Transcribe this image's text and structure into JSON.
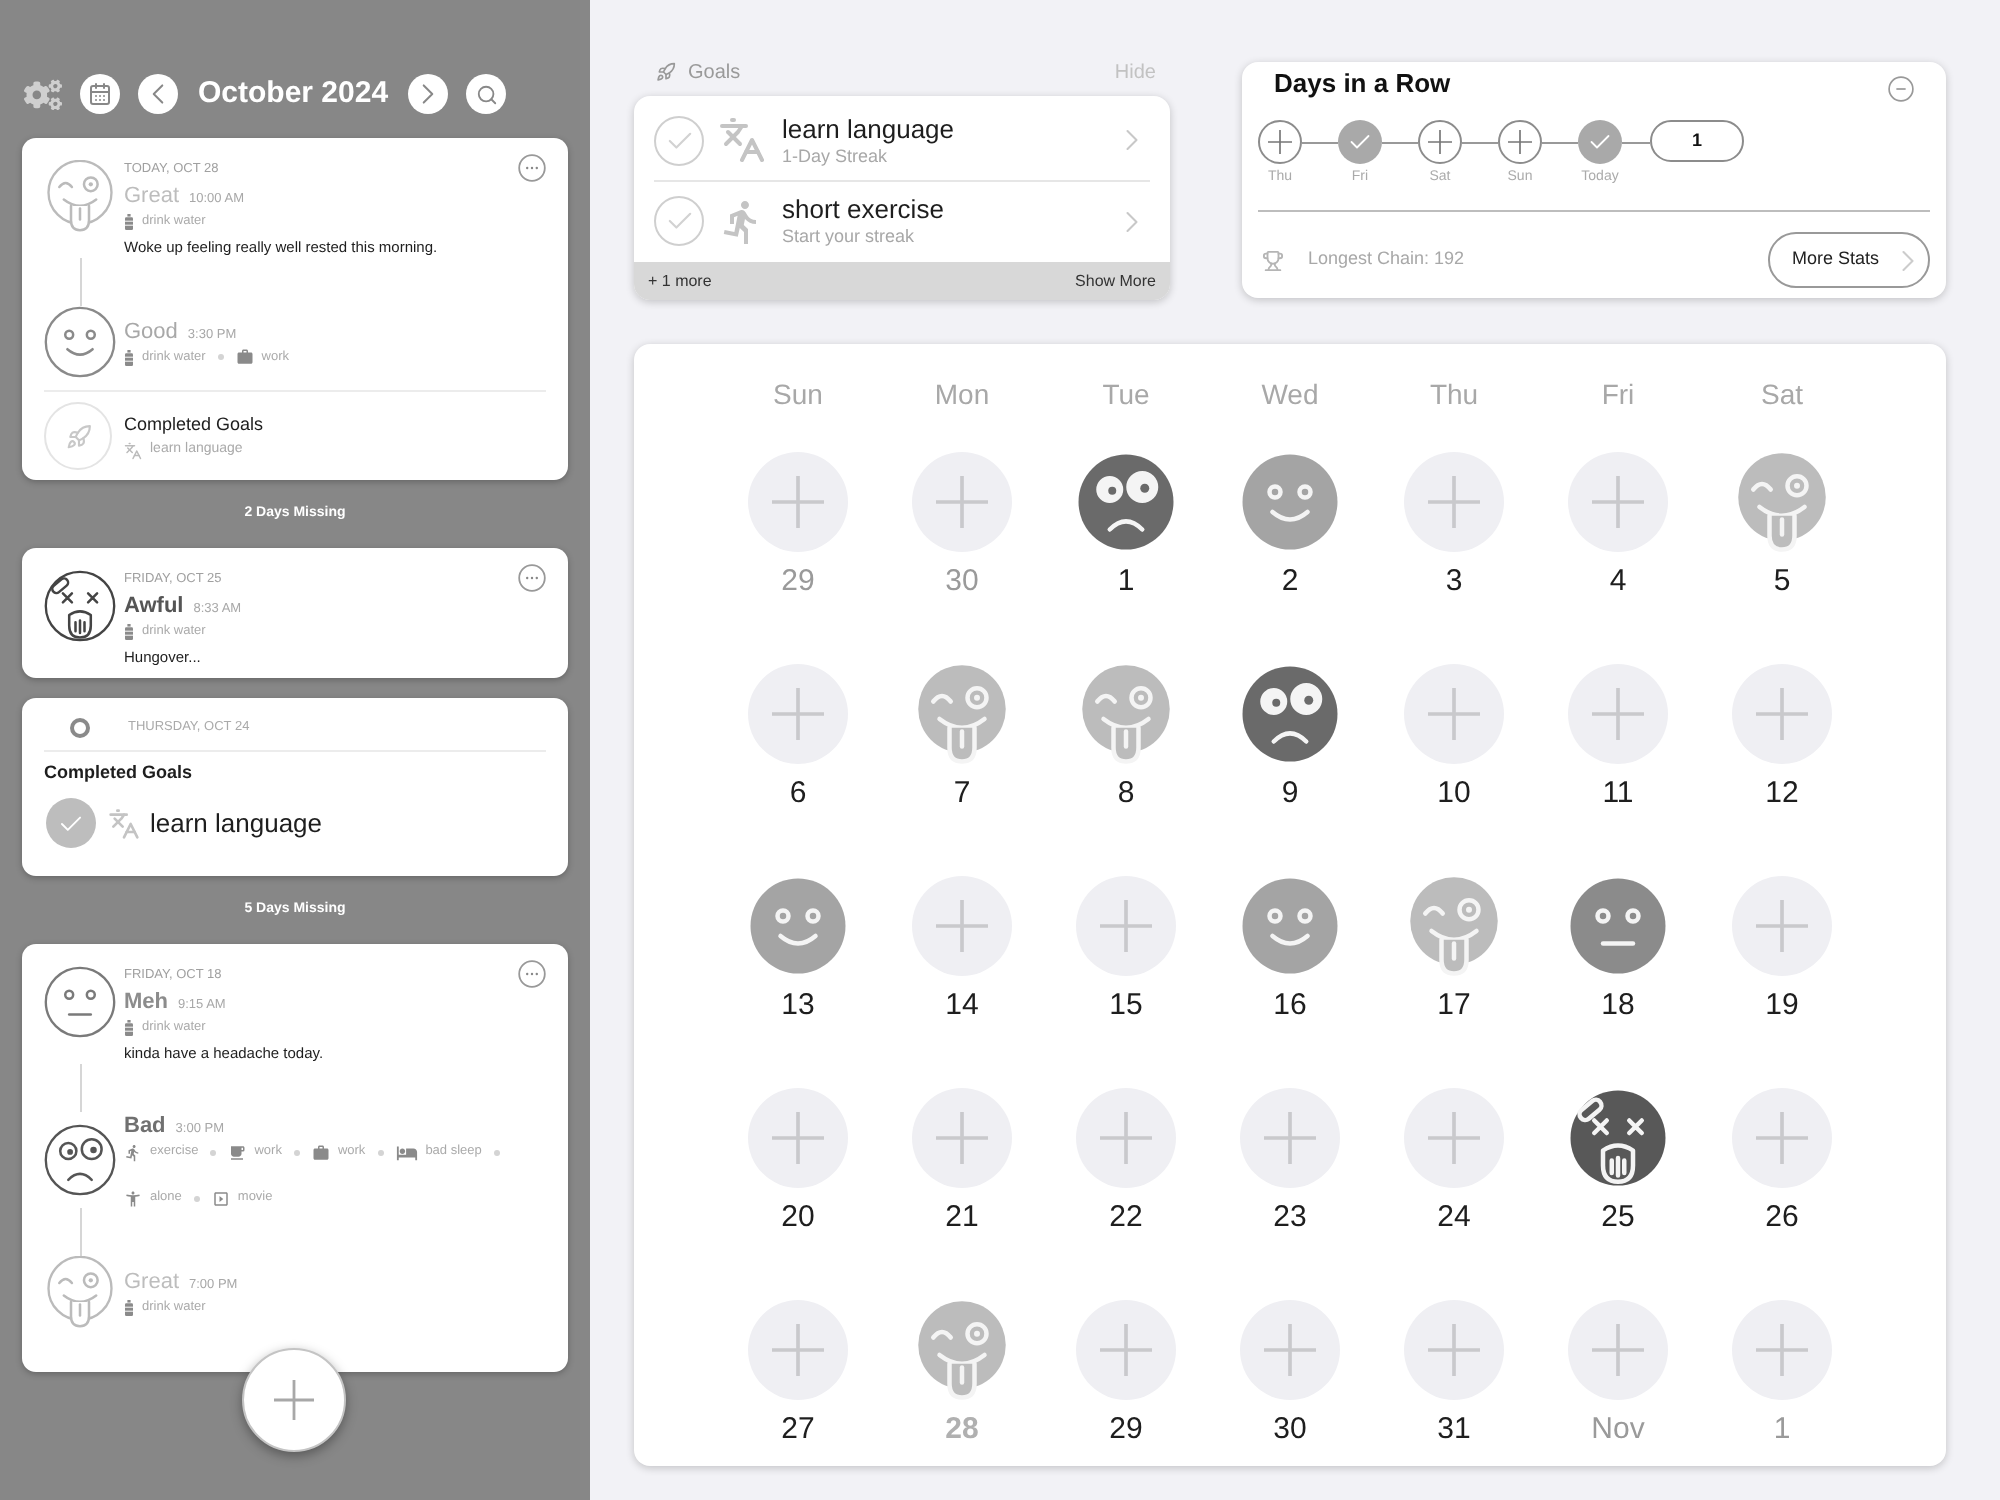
{
  "sidebar": {
    "header": {
      "title": "October 2024"
    },
    "timeline": [
      {
        "kind": "card",
        "date": "TODAY, OCT 28",
        "entries": [
          {
            "kind": "great",
            "label": "Great",
            "time": "10:00 AM",
            "activities": [
              {
                "kind": "water",
                "label": "drink water"
              }
            ],
            "note": "Woke up feeling really well rested this morning."
          },
          {
            "kind": "good",
            "label": "Good",
            "time": "3:30 PM",
            "activities": [
              {
                "kind": "water",
                "label": "drink water"
              },
              {
                "kind": "briefcase",
                "label": "work"
              }
            ]
          }
        ],
        "completed_goals": {
          "title": "Completed Goals",
          "goals": [
            {
              "kind": "language",
              "label": "learn language"
            }
          ]
        }
      },
      {
        "kind": "gap",
        "label": "2 Days Missing"
      },
      {
        "kind": "card",
        "date": "FRIDAY, OCT 25",
        "entries": [
          {
            "kind": "awful",
            "label": "Awful",
            "time": "8:33 AM",
            "activities": [
              {
                "kind": "water",
                "label": "drink water"
              }
            ],
            "note": "Hungover..."
          }
        ]
      },
      {
        "kind": "goals_card",
        "date": "THURSDAY, OCT 24",
        "title": "Completed Goals",
        "goals": [
          {
            "kind": "language",
            "label": "learn language",
            "checked": true
          }
        ]
      },
      {
        "kind": "gap",
        "label": "5 Days Missing"
      },
      {
        "kind": "card",
        "date": "FRIDAY, OCT 18",
        "entries": [
          {
            "kind": "meh",
            "label": "Meh",
            "time": "9:15 AM",
            "activities": [
              {
                "kind": "water",
                "label": "drink water"
              }
            ],
            "note": "kinda have a headache today."
          },
          {
            "kind": "bad",
            "label": "Bad",
            "time": "3:00 PM",
            "activities": [
              {
                "kind": "exercise",
                "label": "exercise"
              },
              {
                "kind": "cup",
                "label": "work"
              },
              {
                "kind": "briefcase",
                "label": "work"
              },
              {
                "kind": "bed",
                "label": "bad sleep"
              },
              {
                "kind": "person",
                "label": "alone"
              },
              {
                "kind": "movie",
                "label": "movie"
              }
            ]
          },
          {
            "kind": "great",
            "label": "Great",
            "time": "7:00 PM",
            "activities": [
              {
                "kind": "water",
                "label": "drink water"
              }
            ]
          }
        ]
      }
    ]
  },
  "goals": {
    "title": "Goals",
    "hide": "Hide",
    "items": [
      {
        "kind": "language",
        "title": "learn language",
        "subtitle": "1-Day Streak",
        "checked": false
      },
      {
        "kind": "exercise",
        "title": "short exercise",
        "subtitle": "Start your streak",
        "checked": false
      }
    ],
    "more": "+ 1 more",
    "show_more": "Show More"
  },
  "streak": {
    "title": "Days in a Row",
    "days": [
      {
        "label": "Thu",
        "kind": "missing"
      },
      {
        "label": "Fri",
        "kind": "done"
      },
      {
        "label": "Sat",
        "kind": "missing"
      },
      {
        "label": "Sun",
        "kind": "missing"
      },
      {
        "label": "Today",
        "kind": "done"
      }
    ],
    "count": "1",
    "longest": "Longest Chain: 192",
    "button": "More Stats"
  },
  "calendar": {
    "weekdays": [
      "Sun",
      "Mon",
      "Tue",
      "Wed",
      "Thu",
      "Fri",
      "Sat"
    ],
    "days": [
      {
        "label": "29",
        "kind": "none",
        "other_month": true,
        "today": false
      },
      {
        "label": "30",
        "kind": "none",
        "other_month": true,
        "today": false
      },
      {
        "label": "1",
        "kind": "bad",
        "other_month": false,
        "today": false
      },
      {
        "label": "2",
        "kind": "good",
        "other_month": false,
        "today": false
      },
      {
        "label": "3",
        "kind": "none",
        "other_month": false,
        "today": false
      },
      {
        "label": "4",
        "kind": "none",
        "other_month": false,
        "today": false
      },
      {
        "label": "5",
        "kind": "great",
        "other_month": false,
        "today": false
      },
      {
        "label": "6",
        "kind": "none",
        "other_month": false,
        "today": false
      },
      {
        "label": "7",
        "kind": "great",
        "other_month": false,
        "today": false
      },
      {
        "label": "8",
        "kind": "great",
        "other_month": false,
        "today": false
      },
      {
        "label": "9",
        "kind": "bad",
        "other_month": false,
        "today": false
      },
      {
        "label": "10",
        "kind": "none",
        "other_month": false,
        "today": false
      },
      {
        "label": "11",
        "kind": "none",
        "other_month": false,
        "today": false
      },
      {
        "label": "12",
        "kind": "none",
        "other_month": false,
        "today": false
      },
      {
        "label": "13",
        "kind": "good",
        "other_month": false,
        "today": false
      },
      {
        "label": "14",
        "kind": "none",
        "other_month": false,
        "today": false
      },
      {
        "label": "15",
        "kind": "none",
        "other_month": false,
        "today": false
      },
      {
        "label": "16",
        "kind": "good",
        "other_month": false,
        "today": false
      },
      {
        "label": "17",
        "kind": "great",
        "other_month": false,
        "today": false
      },
      {
        "label": "18",
        "kind": "meh",
        "other_month": false,
        "today": false
      },
      {
        "label": "19",
        "kind": "none",
        "other_month": false,
        "today": false
      },
      {
        "label": "20",
        "kind": "none",
        "other_month": false,
        "today": false
      },
      {
        "label": "21",
        "kind": "none",
        "other_month": false,
        "today": false
      },
      {
        "label": "22",
        "kind": "none",
        "other_month": false,
        "today": false
      },
      {
        "label": "23",
        "kind": "none",
        "other_month": false,
        "today": false
      },
      {
        "label": "24",
        "kind": "none",
        "other_month": false,
        "today": false
      },
      {
        "label": "25",
        "kind": "awful",
        "other_month": false,
        "today": false
      },
      {
        "label": "26",
        "kind": "none",
        "other_month": false,
        "today": false
      },
      {
        "label": "27",
        "kind": "none",
        "other_month": false,
        "today": false
      },
      {
        "label": "28",
        "kind": "great",
        "other_month": false,
        "today": true
      },
      {
        "label": "29",
        "kind": "none",
        "other_month": false,
        "today": false
      },
      {
        "label": "30",
        "kind": "none",
        "other_month": false,
        "today": false
      },
      {
        "label": "31",
        "kind": "none",
        "other_month": false,
        "today": false
      },
      {
        "label": "Nov",
        "kind": "none",
        "other_month": true,
        "today": false
      },
      {
        "label": "1",
        "kind": "none",
        "other_month": true,
        "today": false
      }
    ]
  }
}
